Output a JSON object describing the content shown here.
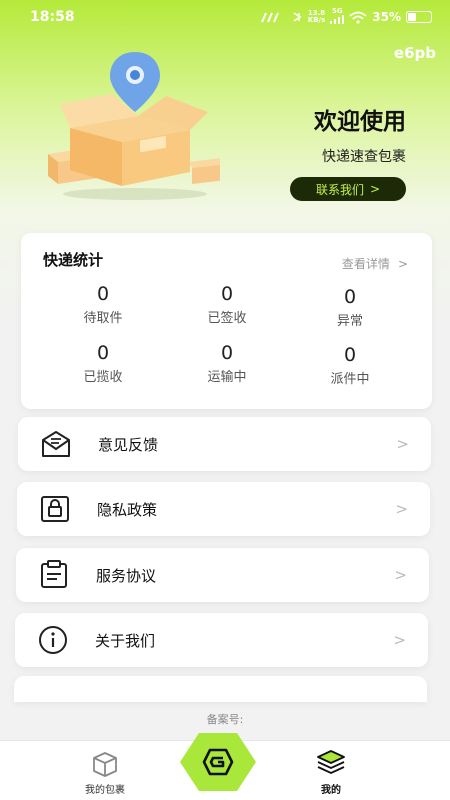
{
  "status_bar": {
    "time": "18:58",
    "net_speed_value": "13.8",
    "net_speed_unit": "KB/s",
    "signal_label": "5G",
    "battery": "35%"
  },
  "header": {
    "user_id": "e6pb",
    "welcome_title": "欢迎使用",
    "welcome_subtitle": "快递速查包裹",
    "contact_button": "联系我们",
    "contact_arrow": ">"
  },
  "stats": {
    "title": "快递统计",
    "more_label": "查看详情",
    "more_arrow": ">",
    "items": [
      {
        "count": "0",
        "label": "待取件"
      },
      {
        "count": "0",
        "label": "已签收"
      },
      {
        "count": "0",
        "label": "异常"
      },
      {
        "count": "0",
        "label": "已揽收"
      },
      {
        "count": "0",
        "label": "运输中"
      },
      {
        "count": "0",
        "label": "派件中"
      }
    ]
  },
  "menu": {
    "arrow": ">",
    "items": [
      {
        "label": "意见反馈",
        "icon": "feedback-mail-icon"
      },
      {
        "label": "隐私政策",
        "icon": "privacy-lock-icon"
      },
      {
        "label": "服务协议",
        "icon": "agreement-doc-icon"
      },
      {
        "label": "关于我们",
        "icon": "info-icon"
      }
    ]
  },
  "footer": {
    "icp_label": "备案号:"
  },
  "tabbar": {
    "items": [
      {
        "label": "我的包裹",
        "icon": "package-box-icon"
      },
      {
        "label": "",
        "icon": "center-logo-icon"
      },
      {
        "label": "我的",
        "icon": "layers-icon"
      }
    ]
  },
  "colors": {
    "accent_green": "#a9e73a",
    "dark_button": "#1c2a08",
    "button_text": "#c6f24c"
  }
}
